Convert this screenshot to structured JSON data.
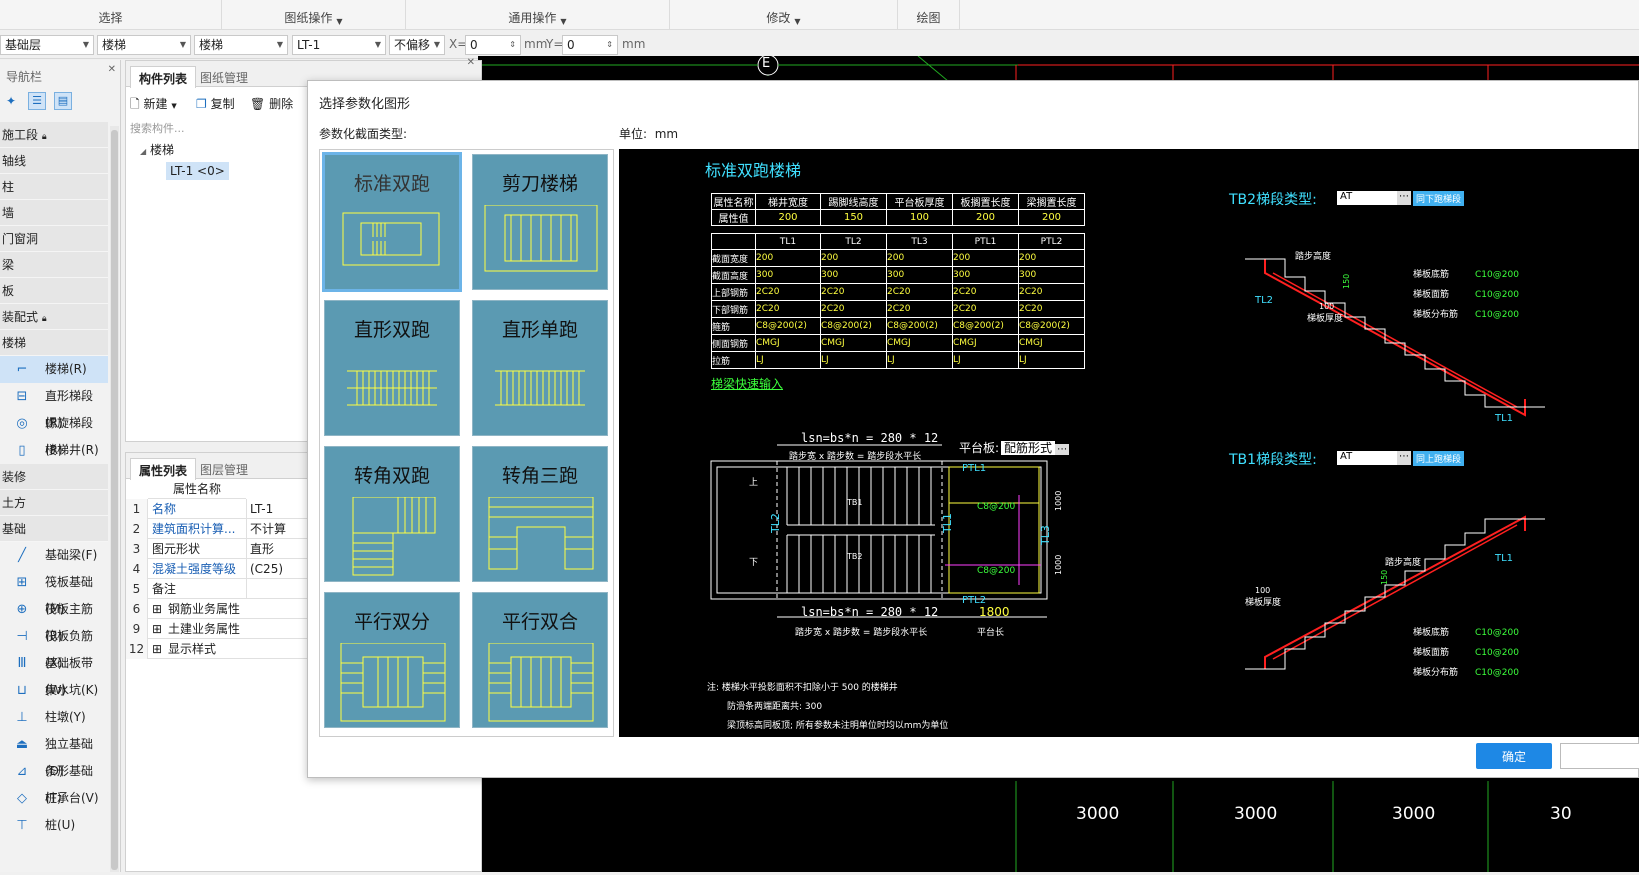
{
  "ribbon": {
    "groups": [
      "选择",
      "图纸操作",
      "通用操作",
      "修改",
      "绘图"
    ]
  },
  "propbar": {
    "floor": "基础层",
    "category": "楼梯",
    "subcategory": "楼梯",
    "component": "LT-1",
    "offset_mode": "不偏移",
    "x_label": "X=",
    "x_value": "0",
    "x_unit": "mm",
    "y_label": "Y=",
    "y_value": "0",
    "y_unit": "mm"
  },
  "nav": {
    "title": "导航栏",
    "groups": [
      {
        "label": "施工段"
      },
      {
        "label": "轴线"
      },
      {
        "label": "柱"
      },
      {
        "label": "墙"
      },
      {
        "label": "门窗洞"
      },
      {
        "label": "梁"
      },
      {
        "label": "板"
      },
      {
        "label": "装配式"
      },
      {
        "label": "楼梯"
      }
    ],
    "stair_items": [
      "楼梯(R)",
      "直形梯段(R)",
      "螺旋梯段(R)",
      "楼梯井(R)"
    ],
    "groups2": [
      "装修",
      "土方",
      "基础"
    ],
    "foundation_items": [
      "基础梁(F)",
      "筏板基础(M)",
      "筏板主筋(R)",
      "筏板负筋(X)",
      "基础板带(W)",
      "集水坑(K)",
      "柱墩(Y)",
      "独立基础(D)",
      "条形基础(T)",
      "桩承台(V)",
      "桩(U)"
    ]
  },
  "comp_panel": {
    "tabs": [
      "构件列表",
      "图纸管理"
    ],
    "toolbar": {
      "new": "新建",
      "copy": "复制",
      "delete": "删除"
    },
    "search_placeholder": "搜索构件...",
    "tree_root": "楼梯",
    "tree_child": "LT-1 <0>"
  },
  "prop_panel": {
    "tabs": [
      "属性列表",
      "图层管理"
    ],
    "header": "属性名称",
    "rows": [
      {
        "n": "1",
        "k": "名称",
        "v": "LT-1",
        "blue": true
      },
      {
        "n": "2",
        "k": "建筑面积计算...",
        "v": "不计算",
        "blue": true
      },
      {
        "n": "3",
        "k": "图元形状",
        "v": "直形",
        "blue": false
      },
      {
        "n": "4",
        "k": "混凝土强度等级",
        "v": "(C25)",
        "blue": true
      },
      {
        "n": "5",
        "k": "备注",
        "v": "",
        "blue": false
      },
      {
        "n": "6",
        "k": "钢筋业务属性",
        "v": "",
        "blue": false
      },
      {
        "n": "9",
        "k": "土建业务属性",
        "v": "",
        "blue": false
      },
      {
        "n": "12",
        "k": "显示样式",
        "v": "",
        "blue": false
      }
    ]
  },
  "cad": {
    "axis_label": "E",
    "dims": [
      "3000",
      "3000",
      "3000",
      "30"
    ]
  },
  "dialog": {
    "title": "选择参数化图形",
    "type_label": "参数化截面类型:",
    "unit_label": "单位:",
    "unit_value": "mm",
    "shapes": [
      "标准双跑",
      "剪刀楼梯",
      "直形双跑",
      "直形单跑",
      "转角双跑",
      "转角三跑",
      "平行双分",
      "平行双合"
    ],
    "ok": "确定"
  },
  "preview": {
    "title": "标准双跑楼梯",
    "table1_head": [
      "属性名称",
      "梯井宽度",
      "踢脚线高度",
      "平台板厚度",
      "板搁置长度",
      "梁搁置长度"
    ],
    "table1_vals": [
      "属性值",
      "200",
      "150",
      "100",
      "200",
      "200"
    ],
    "table2_head": [
      "",
      "TL1",
      "TL2",
      "TL3",
      "PTL1",
      "PTL2"
    ],
    "table2_rows": [
      [
        "截面宽度",
        "200",
        "200",
        "200",
        "200",
        "200"
      ],
      [
        "截面高度",
        "300",
        "300",
        "300",
        "300",
        "300"
      ],
      [
        "上部钢筋",
        "2C20",
        "2C20",
        "2C20",
        "2C20",
        "2C20"
      ],
      [
        "下部钢筋",
        "2C20",
        "2C20",
        "2C20",
        "2C20",
        "2C20"
      ],
      [
        "箍筋",
        "C8@200(2)",
        "C8@200(2)",
        "C8@200(2)",
        "C8@200(2)",
        "C8@200(2)"
      ],
      [
        "侧面钢筋",
        "CMGJ",
        "CMGJ",
        "CMGJ",
        "CMGJ",
        "CMGJ"
      ],
      [
        "拉筋",
        "LJ",
        "LJ",
        "LJ",
        "LJ",
        "LJ"
      ]
    ],
    "quick_input": "梯梁快速输入",
    "lsn_top": "lsn=bs*n = 280 * 12",
    "lsn_note": "踏步宽 x 踏步数 = 踏步段水平长",
    "platform_label": "平台板:",
    "platform_value": "配筋形式",
    "lsn_bottom": "lsn=bs*n = 280 * 12",
    "platform_len": "1800",
    "platform_len_label": "平台长",
    "tb2_label": "TB2梯段类型:",
    "tb2_value": "AT",
    "tb2_btn": "同下跑梯段",
    "tb1_label": "TB1梯段类型:",
    "tb1_value": "AT",
    "tb1_btn": "同上跑梯段",
    "rebar_bottom": "梯板底筋",
    "rebar_top": "梯板面筋",
    "rebar_dist": "梯板分布筋",
    "rebar_val": "C10@200",
    "step_h": "踏步高度",
    "board_t": "梯板厚度",
    "notes": [
      "注: 楼梯水平投影面积不扣除小于 500 的楼梯井",
      "防滑条两端距离共: 300",
      "梁顶标高同板顶; 所有参数未注明单位时均以mm为单位"
    ]
  }
}
